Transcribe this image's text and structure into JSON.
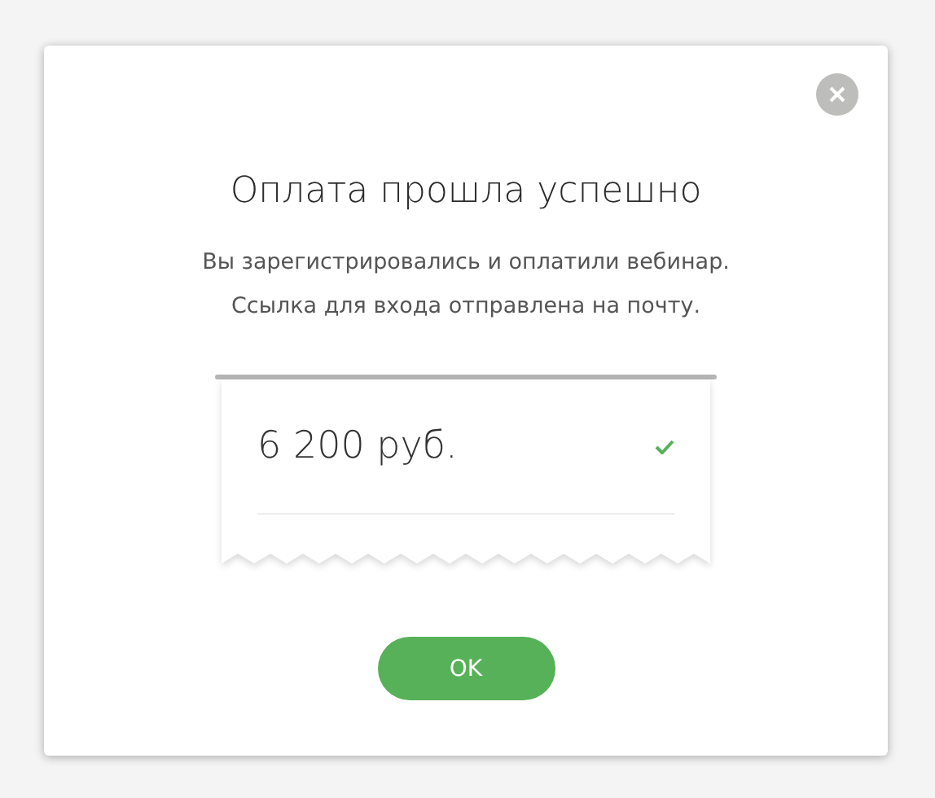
{
  "dialog": {
    "title": "Оплата прошла успешно",
    "message_lines": [
      "Вы зарегистрировались и оплатили вебинар.",
      "Ссылка для входа отправлена на почту."
    ]
  },
  "receipt": {
    "amount": "6 200 руб.",
    "paid": true
  },
  "buttons": [
    "OK"
  ]
}
